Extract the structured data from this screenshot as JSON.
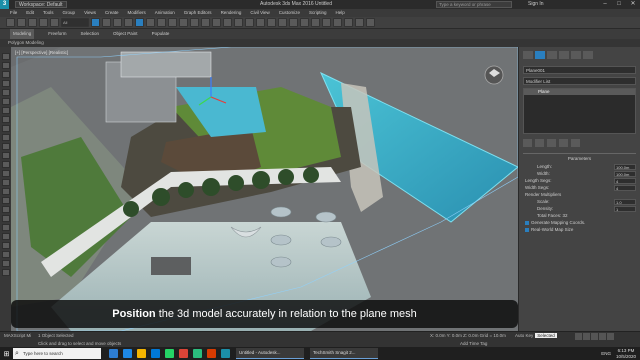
{
  "window": {
    "workspace": "Workspace: Default",
    "title": "Autodesk 3ds Max 2016    Untitled",
    "search_placeholder": "Type a keyword or phrase",
    "sign_in": "Sign In"
  },
  "menu": [
    "File",
    "Edit",
    "Tools",
    "Group",
    "Views",
    "Create",
    "Modifiers",
    "Animation",
    "Graph Editors",
    "Rendering",
    "Civil View",
    "Customize",
    "Scripting",
    "Help"
  ],
  "toolbar": {
    "selection_filter": "All"
  },
  "ribbon": {
    "tabs": [
      "Modeling",
      "Freeform",
      "Selection",
      "Object Paint",
      "Populate"
    ],
    "active_tab": "Modeling",
    "sub_label": "Polygon Modeling"
  },
  "viewport": {
    "label": "[+] [Perspective] [Realistic]"
  },
  "command_panel": {
    "name_value": "Plane001",
    "modifier_list": "Modifier List",
    "stack_item": "Plane",
    "parameters_title": "Parameters",
    "params": [
      {
        "label": "Length:",
        "value": "100.0m"
      },
      {
        "label": "Width:",
        "value": "100.0m"
      }
    ],
    "segs_label_1": "Length Segs:",
    "segs_value_1": "4",
    "segs_label_2": "Width Segs:",
    "segs_value_2": "4",
    "render_mult": "Render Multipliers",
    "scale_label": "Scale:",
    "scale_value": "1.0",
    "density_label": "Density:",
    "density_value": "1",
    "total_faces": "Total Faces: 32",
    "gen_mapping": "Generate Mapping Coords.",
    "real_world": "Real-World Map Size"
  },
  "status": {
    "timeline": "0 / 100",
    "maxscript": "MAXScript Mi",
    "selected": "1 Object Selected",
    "prompt": "Click and drag to select and move objects",
    "coords": "X: 0.0m   Y: 0.0m   Z: 0.0m   Grid = 10.0m",
    "autokey": "Auto Key",
    "selected_btn": "Selected",
    "setkey": "Set Key",
    "key_filters": "Key Filters...",
    "add_time_tag": "Add Time Tag"
  },
  "caption": {
    "bold": "Position",
    "rest": " the 3d model accurately in relation to the plane mesh"
  },
  "taskbar": {
    "search": "Type here to search",
    "apps": [
      "Untitled - Autodesk...",
      "TechSmith Snagit 2..."
    ],
    "lang": "ENG",
    "time": "6:13 PM",
    "date": "10/5/2020"
  }
}
